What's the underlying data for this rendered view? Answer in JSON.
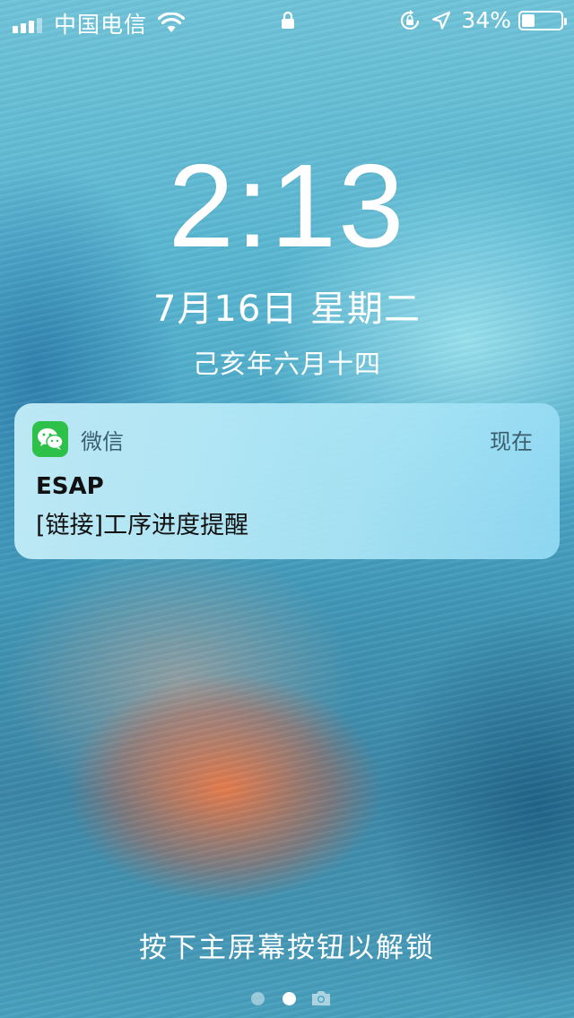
{
  "status_bar": {
    "carrier": "中国电信",
    "battery_percent": "34%",
    "battery_level": 0.34,
    "icons": [
      "signal-icon",
      "wifi-icon",
      "lock-icon",
      "rotation-lock-icon",
      "location-arrow-icon",
      "battery-icon"
    ]
  },
  "lock_screen": {
    "time": "2:13",
    "date": "7月16日 星期二",
    "lunar_date": "己亥年六月十四",
    "unlock_hint": "按下主屏幕按钮以解锁"
  },
  "notification": {
    "app_name": "微信",
    "time": "现在",
    "title": "ESAP",
    "body": "[链接]工序进度提醒",
    "app_icon": "wechat-icon",
    "accent_color": "#2dc14a"
  },
  "pager": {
    "pages": 2,
    "active_index": 1,
    "trailing_icon": "camera-icon"
  }
}
